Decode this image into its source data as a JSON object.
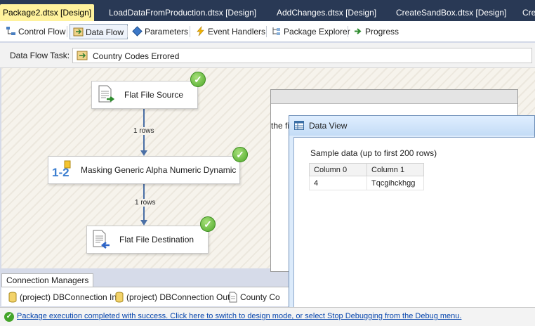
{
  "doc_tabs": [
    "Package2.dtsx [Design]",
    "LoadDataFromProduction.dtsx [Design]",
    "AddChanges.dtsx [Design]",
    "CreateSandBox.dtsx [Design]",
    "Cre"
  ],
  "designer_tabs": [
    "Control Flow",
    "Data Flow",
    "Parameters",
    "Event Handlers",
    "Package Explorer",
    "Progress"
  ],
  "task": {
    "label": "Data Flow Task:",
    "value": "Country Codes Errored"
  },
  "flow": {
    "source": "Flat File Source",
    "transform": "Masking Generic Alpha Numeric Dynamic",
    "destination": "Flat File Destination",
    "link1": "1 rows",
    "link2": "1 rows"
  },
  "bg_window": {
    "snippet": "the fi"
  },
  "data_view": {
    "title": "Data View",
    "sample": "Sample data (up to first 200 rows)",
    "columns": [
      "Column 0",
      "Column 1"
    ],
    "rows": [
      [
        "4",
        "Tqcgihckhgg"
      ]
    ]
  },
  "connections": {
    "tab": "Connection Managers",
    "items": [
      "(project) DBConnection In",
      "(project) DBConnection Out",
      "County Co"
    ]
  },
  "status": {
    "message": "Package execution completed with success. Click here to switch to design mode, or select Stop Debugging from the Debug menu."
  }
}
